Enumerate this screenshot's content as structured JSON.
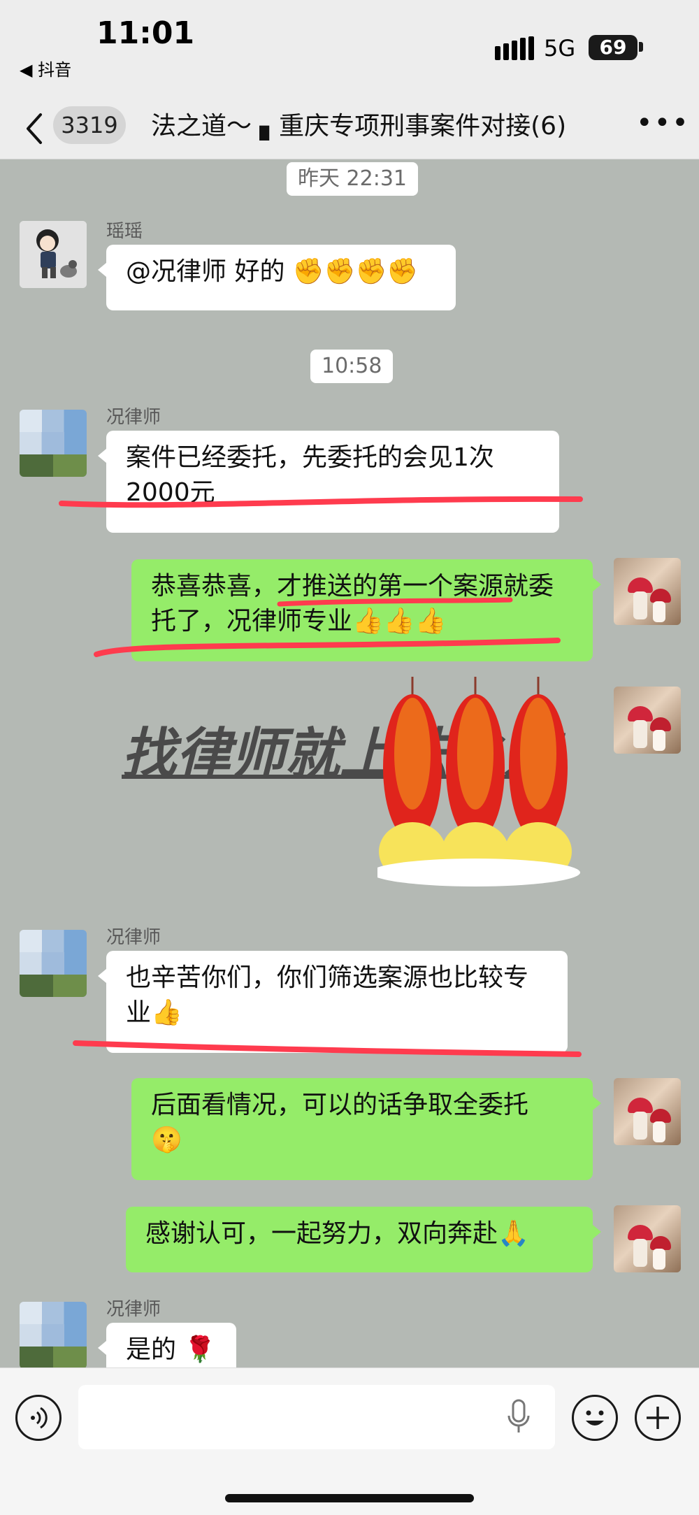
{
  "status_bar": {
    "time": "11:01",
    "back_app": "◀ 抖音",
    "network": "5G",
    "battery": "69"
  },
  "nav": {
    "unread_count": "3319",
    "title": "法之道～ ▖重庆专项刑事案件对接(6)",
    "more": "•••"
  },
  "messages": [
    {
      "type": "timestamp",
      "text": "昨天 22:31"
    },
    {
      "type": "incoming",
      "sender": "瑶瑶",
      "text": "@况律师 好的",
      "emoji": "✊✊✊✊"
    },
    {
      "type": "timestamp",
      "text": "10:58"
    },
    {
      "type": "incoming",
      "sender": "况律师",
      "text": "案件已经委托，先委托的会见1次2000元"
    },
    {
      "type": "outgoing",
      "text": "恭喜恭喜，才推送的第一个案源就委托了，况律师专业",
      "emoji": "👍👍👍"
    },
    {
      "type": "sticker",
      "text": "找律师就上法之道"
    },
    {
      "type": "incoming",
      "sender": "况律师",
      "text": "也辛苦你们，你们筛选案源也比较专业",
      "emoji": "👍"
    },
    {
      "type": "outgoing",
      "text": "后面看情况，可以的话争取全委托",
      "emoji": "🤫"
    },
    {
      "type": "outgoing",
      "text": "感谢认可，一起努力，双向奔赴",
      "emoji": "🙏"
    },
    {
      "type": "incoming",
      "sender": "况律师",
      "text": "是的",
      "emoji": "🌹"
    }
  ],
  "colors": {
    "chat_bg": "#b4b9b4",
    "bubble_out": "#95ec69",
    "bubble_in": "#ffffff",
    "annotation_red": "#ff3b4e"
  },
  "input_bar": {
    "voice_icon": "voice-icon",
    "mic_icon": "mic-icon",
    "emoji_icon": "emoji-icon",
    "plus_icon": "plus-icon"
  }
}
